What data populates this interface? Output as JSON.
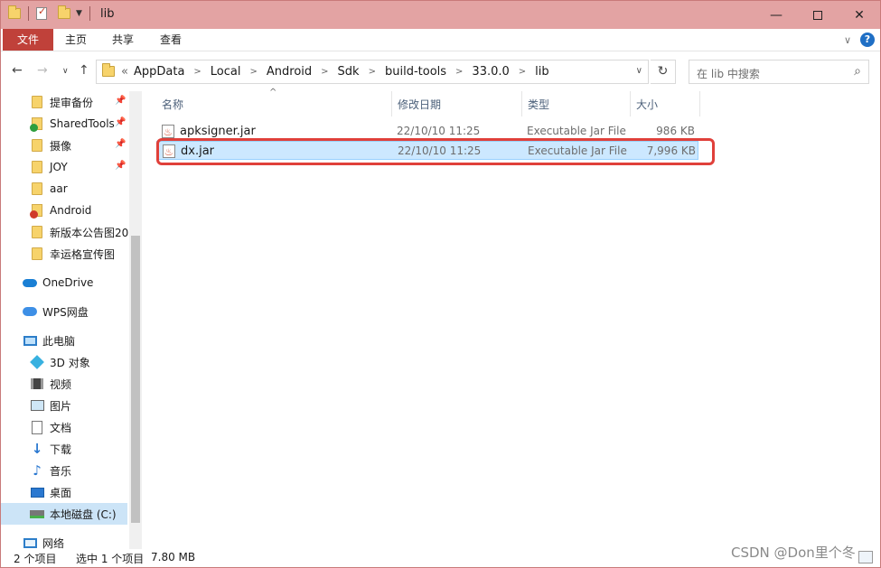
{
  "window": {
    "title": "lib"
  },
  "ribbon": {
    "tabs": [
      "文件",
      "主页",
      "共享",
      "查看"
    ]
  },
  "address": {
    "prefix": "«",
    "crumbs": [
      "AppData",
      "Local",
      "Android",
      "Sdk",
      "build-tools",
      "33.0.0",
      "lib"
    ]
  },
  "search": {
    "placeholder": "在 lib 中搜索"
  },
  "sidebar": {
    "quick_access": [
      {
        "label": "提审备份",
        "icon": "folder-icon",
        "pinned": true
      },
      {
        "label": "SharedTools",
        "icon": "shared-folder-icon",
        "pinned": true
      },
      {
        "label": "摄像",
        "icon": "folder-icon",
        "pinned": true
      },
      {
        "label": "JOY",
        "icon": "folder-icon",
        "pinned": true
      },
      {
        "label": "aar",
        "icon": "folder-icon",
        "pinned": false
      },
      {
        "label": "Android",
        "icon": "warning-folder-icon",
        "pinned": false
      },
      {
        "label": "新版本公告图20",
        "icon": "folder-icon",
        "pinned": false
      },
      {
        "label": "幸运格宣传图",
        "icon": "folder-icon",
        "pinned": false
      }
    ],
    "onedrive": "OneDrive",
    "wps": "WPS网盘",
    "this_pc": "此电脑",
    "pc_items": [
      {
        "label": "3D 对象",
        "icon": "3d-objects-icon"
      },
      {
        "label": "视频",
        "icon": "video-icon"
      },
      {
        "label": "图片",
        "icon": "pictures-icon"
      },
      {
        "label": "文档",
        "icon": "documents-icon"
      },
      {
        "label": "下载",
        "icon": "download-icon"
      },
      {
        "label": "音乐",
        "icon": "music-icon"
      },
      {
        "label": "桌面",
        "icon": "desktop-icon"
      },
      {
        "label": "本地磁盘 (C:)",
        "icon": "local-disk-icon"
      }
    ],
    "network": "网络"
  },
  "columns": {
    "name": "名称",
    "date": "修改日期",
    "type": "类型",
    "size": "大小"
  },
  "files": [
    {
      "name": "apksigner.jar",
      "date": "22/10/10 11:25",
      "type": "Executable Jar File",
      "size": "986 KB",
      "selected": false
    },
    {
      "name": "dx.jar",
      "date": "22/10/10 11:25",
      "type": "Executable Jar File",
      "size": "7,996 KB",
      "selected": true
    }
  ],
  "status": {
    "count": "2 个项目",
    "selection": "选中 1 个项目",
    "size": "7.80 MB"
  },
  "watermark": "CSDN @Don里个冬",
  "colors": {
    "titlebar": "#e3a3a3",
    "file_tab": "#c0413a",
    "selection": "#cce8ff",
    "highlight_box": "#e0403a"
  }
}
